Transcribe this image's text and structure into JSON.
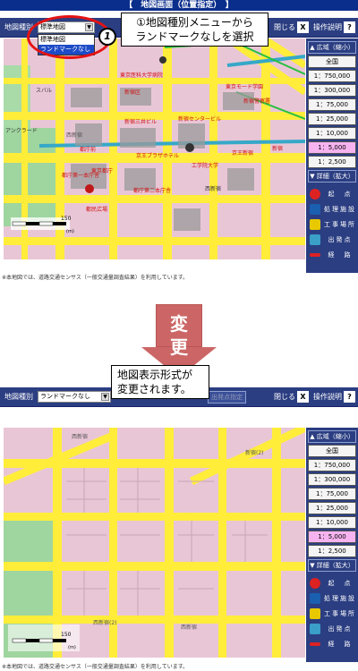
{
  "screen1": {
    "title": "【　地図画面（位置指定）　】",
    "map_type_label": "地図種別",
    "map_type_value": "標準地図",
    "dropdown_options": [
      "標準地図",
      "ランドマークなし"
    ],
    "close_label": "閉じる",
    "close_glyph": "X",
    "help_label": "操作説明",
    "help_glyph": "?",
    "callout_num": "1",
    "callout_line1": "①地図種別メニューから",
    "callout_line2": "ランドマークなしを選択",
    "footnote": "※本地図では、道路交通センサス（一般交通量調査結果）を利用しています。",
    "map_labels": [
      "東京都庁",
      "東京医科大学病院",
      "西新宿",
      "都庁第一本庁舎",
      "都民広場",
      "新宿区",
      "京王プラザホテル",
      "新宿センタービル",
      "工学院大学",
      "東京モード学園",
      "スバル",
      "新宿三井ビル",
      "都庁第二本庁舎",
      "アンクラード",
      "都庁前",
      "西新宿",
      "新宿",
      "京王新宿",
      "新宿警察署"
    ],
    "scale_label": "150",
    "scale_unit": "(m)"
  },
  "screen2": {
    "map_type_label": "地図種別",
    "map_type_value": "ランドマークなし",
    "departure_btn": "出発点指定",
    "close_label": "閉じる",
    "close_glyph": "X",
    "help_label": "操作説明",
    "help_glyph": "?",
    "callout_line1": "地図表示形式が",
    "callout_line2": "変更されます。",
    "footnote": "※本地図では、道路交通センサス（一般交通量調査結果）を利用しています。",
    "map_labels": [
      "西新宿",
      "西新宿(2)",
      "新宿(2)",
      "西新宿"
    ],
    "scale_label": "150",
    "scale_unit": "(m)"
  },
  "arrow": {
    "line1": "変",
    "line2": "更"
  },
  "right_panel": {
    "head_wide": "▲ 広域（縮小）",
    "scales": [
      "全国",
      "1：750,000",
      "1：300,000",
      "1：75,000",
      "1：25,000",
      "1：10,000",
      "1：5,000",
      "1：2,500"
    ],
    "selected_scale": "1：5,000",
    "head_detail": "▼ 詳細（拡大）",
    "legend": [
      {
        "label": "起　点",
        "color": "#d22",
        "icon": "start-point-icon"
      },
      {
        "label": "処理施設",
        "color": "#1a5fb0",
        "icon": "facility-icon"
      },
      {
        "label": "工事場所",
        "color": "#e8c800",
        "icon": "construction-icon"
      },
      {
        "label": "出発点",
        "color": "#3aa0c8",
        "icon": "departure-icon"
      },
      {
        "label": "経　路",
        "color": "#d22",
        "icon": "route-icon"
      }
    ]
  }
}
